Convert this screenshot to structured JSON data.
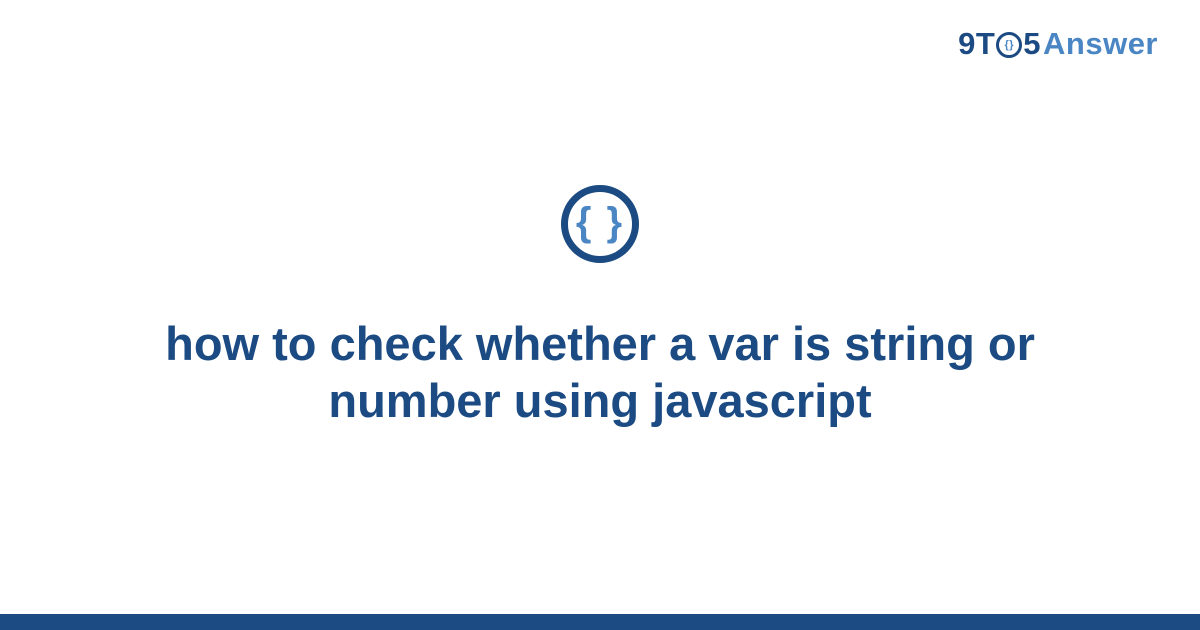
{
  "brand": {
    "prefix": "9T",
    "five": "5",
    "suffix": "Answer"
  },
  "badge": {
    "glyph": "{ }"
  },
  "title": "how to check whether a var is string or number using javascript"
}
